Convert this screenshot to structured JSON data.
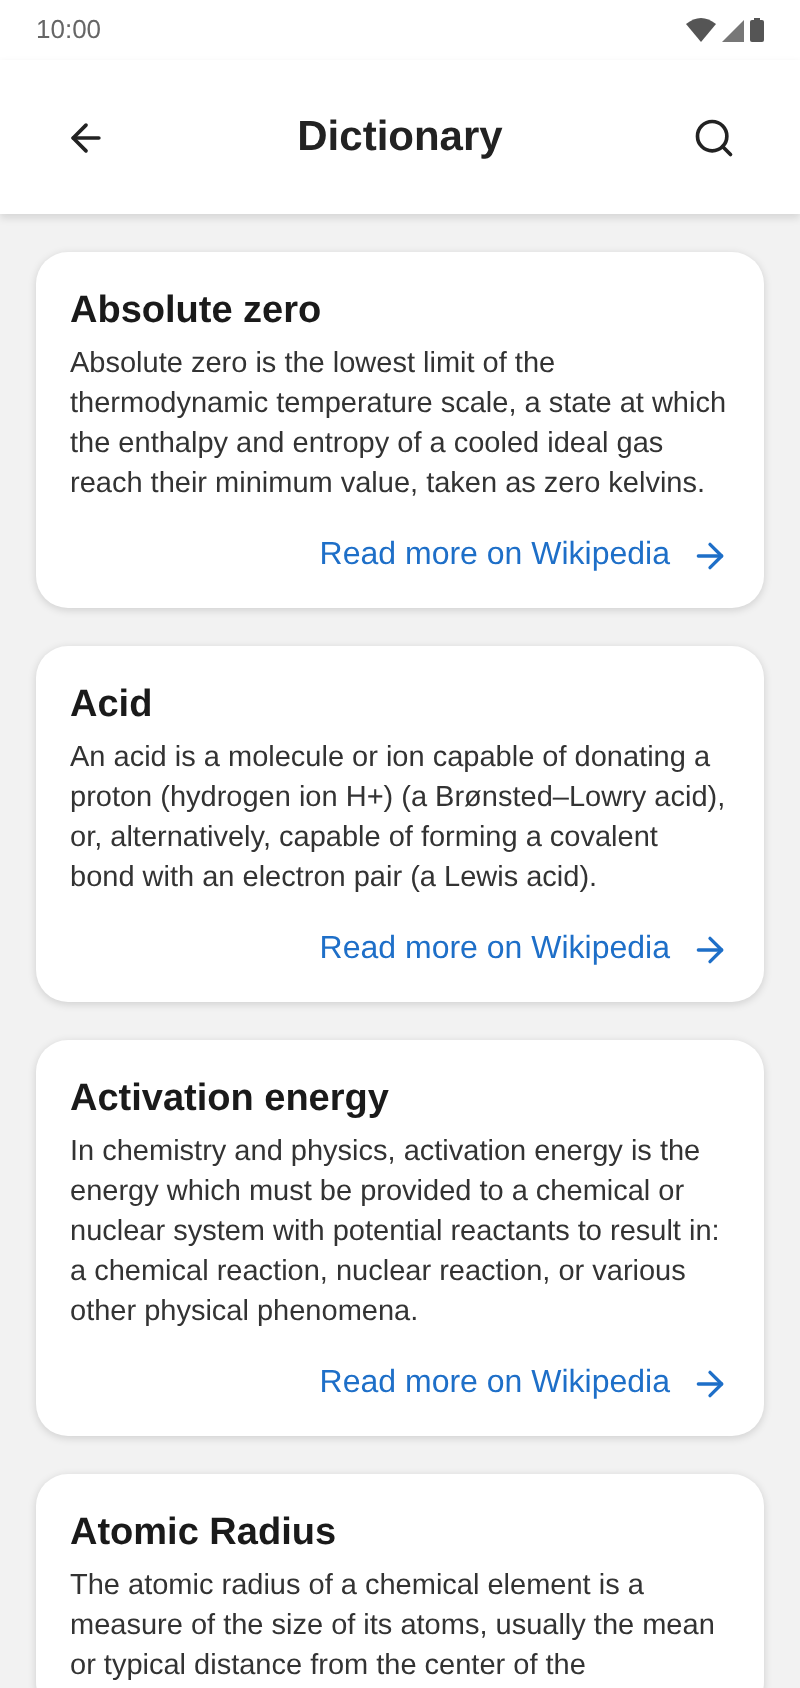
{
  "status_bar": {
    "time": "10:00"
  },
  "app_bar": {
    "title": "Dictionary"
  },
  "entries": [
    {
      "title": "Absolute zero",
      "definition": "Absolute zero is the lowest limit of the thermodynamic temperature scale, a state at which the enthalpy and entropy of a cooled ideal gas reach their minimum value, taken as zero kelvins.",
      "link": "Read more on Wikipedia"
    },
    {
      "title": "Acid",
      "definition": "An acid is a molecule or ion capable of donating a proton (hydrogen ion H+) (a Brønsted–Lowry acid), or, alternatively, capable of forming a covalent bond with an electron pair (a Lewis acid).",
      "link": "Read more on Wikipedia"
    },
    {
      "title": "Activation energy",
      "definition": "In chemistry and physics, activation energy is the energy which must be provided to a chemical or nuclear system with potential reactants to result in: a chemical reaction, nuclear reaction, or various other physical phenomena.",
      "link": "Read more on Wikipedia"
    },
    {
      "title": "Atomic Radius",
      "definition": "The atomic radius of a chemical element is a measure of the size of its atoms, usually the mean or typical distance from the center of the"
    }
  ]
}
